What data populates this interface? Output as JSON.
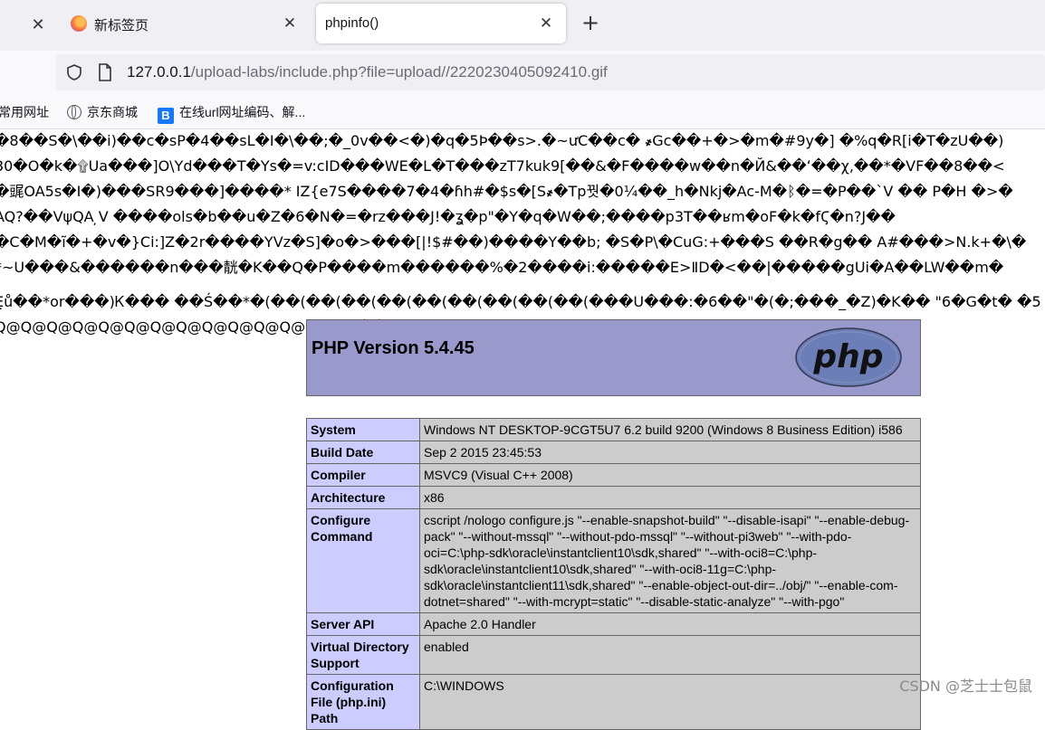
{
  "tabs": [
    {
      "title": "新标签页",
      "active": false
    },
    {
      "title": "phpinfo()",
      "active": true
    }
  ],
  "url": {
    "host": "127.0.0.1",
    "path": "/upload-labs/include.php?file=upload//2220230405092410.gif"
  },
  "bookmarks": [
    {
      "label": "常用网址"
    },
    {
      "label": "京东商城",
      "icon": "globe-icon"
    },
    {
      "label": "在线url网址编码、解...",
      "icon": "b-logo-icon"
    }
  ],
  "garbage_lines": [
    "�8��S�\\��i)��c�sP�4��sL�I�\\��;�_0v��<�)�q�5Þ��s>.�~ưC��c� ҂Gc��+�>�m�#9y�] �%q�R[i�T�zU��)",
    "30�O�k�۩Ua���]O\\Yd���T�Ys�=v:cID���WE�L�T���zT7kuk9[��&�F����w��n�Й&��ʻ��χ,��*�VF��8��<",
    "�䜸OA5s�I�)���SR9���]����* IZ{e7S����7�4�ɦh#�$s�[S҂�Tp꿧�0¼��_h�Nkj�Ac-M�ᛒ�=�P��`V �� P�H �>�",
    "AQ?��VψQA ̦V ����ols�b��u�Z�6�N�=�rz���J!�ʓ�p\"�Y�q�W��;����p3T��ʁm�oF�k�fϚ�n?J��",
    "�C�M�ĩ�+�v�}Ci:]Z�2r����YVz�S]�o�>���[|!$#��)����Y��b; �S�P\\�CuG:+���S ��R�g�� A#���>N.k+�\\�",
    "*~U���&������n���靗�K��Q�P����m������%�2����i:�����E>ⅡD�<��|�����gUi�A��LW��m�",
    "",
    "E̤ů��*or���)Ꮶ��� ��Ś��*�(��(��(��(��(��(��(��(��(��(���U���:�6��\"�(�;���_�Z)�K�� \"6�G�t� �5",
    "Q@Q@Q@Q@Q@Q@Q@Q@Q@Q@Q@Q@Q@Q@��"
  ],
  "php": {
    "version_title": "PHP Version 5.4.45",
    "logo_text": "php"
  },
  "info_rows": [
    {
      "key": "System",
      "value": "Windows NT DESKTOP-9CGT5U7 6.2 build 9200 (Windows 8 Business Edition) i586"
    },
    {
      "key": "Build Date",
      "value": "Sep 2 2015 23:45:53"
    },
    {
      "key": "Compiler",
      "value": "MSVC9 (Visual C++ 2008)"
    },
    {
      "key": "Architecture",
      "value": "x86"
    },
    {
      "key": "Configure Command",
      "value": "cscript /nologo configure.js \"--enable-snapshot-build\" \"--disable-isapi\" \"--enable-debug-pack\" \"--without-mssql\" \"--without-pdo-mssql\" \"--without-pi3web\" \"--with-pdo-oci=C:\\php-sdk\\oracle\\instantclient10\\sdk,shared\" \"--with-oci8=C:\\php-sdk\\oracle\\instantclient10\\sdk,shared\" \"--with-oci8-11g=C:\\php-sdk\\oracle\\instantclient11\\sdk,shared\" \"--enable-object-out-dir=../obj/\" \"--enable-com-dotnet=shared\" \"--with-mcrypt=static\" \"--disable-static-analyze\" \"--with-pgo\""
    },
    {
      "key": "Server API",
      "value": "Apache 2.0 Handler"
    },
    {
      "key": "Virtual Directory Support",
      "value": "enabled"
    },
    {
      "key": "Configuration File (php.ini) Path",
      "value": "C:\\WINDOWS"
    }
  ],
  "watermark": "CSDN @芝士士包鼠",
  "colors": {
    "header_bg": "#9999cc",
    "key_cell_bg": "#ccccff",
    "value_cell_bg": "#cccccc"
  }
}
